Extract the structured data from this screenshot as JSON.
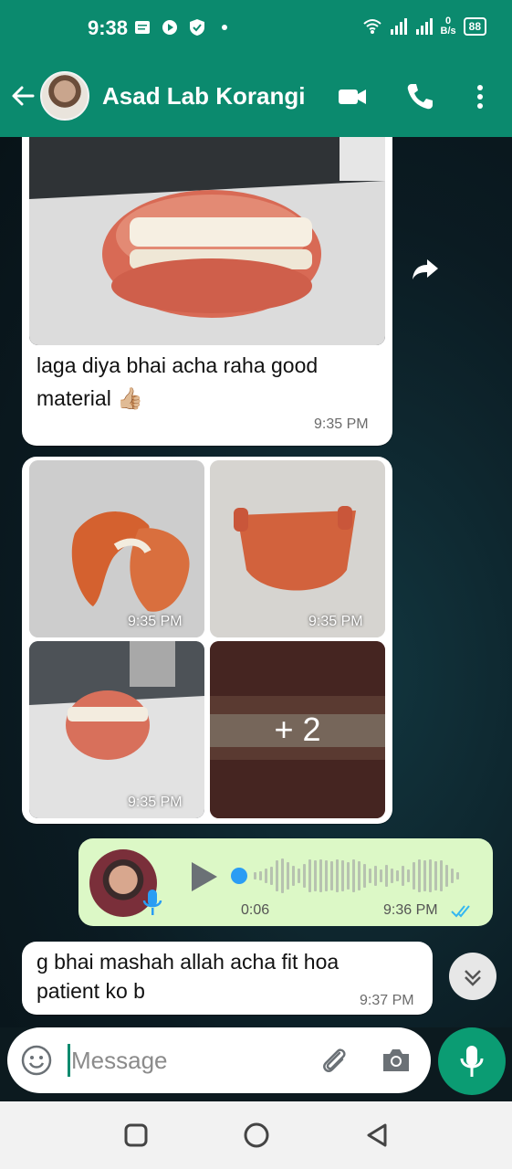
{
  "status_bar": {
    "time": "9:38",
    "net_speed_value": "0",
    "net_speed_unit": "B/s",
    "battery": "88"
  },
  "header": {
    "contact_name": "Asad Lab Korangi"
  },
  "messages": {
    "first": {
      "text_line1": "laga diya bhai acha raha  good",
      "text_line2": "material",
      "emoji": "👍🏼",
      "time": "9:35 PM"
    },
    "gallery": {
      "times": [
        "9:35 PM",
        "9:35 PM",
        "9:35 PM"
      ],
      "more_count": "+ 2"
    },
    "voice": {
      "duration": "0:06",
      "time": "9:36 PM"
    },
    "last": {
      "text_line1": "g bhai mashah allah acha fit hoa",
      "text_line2": "patient ko  b",
      "time": "9:37 PM"
    }
  },
  "composer": {
    "placeholder": "Message"
  },
  "icons": {
    "back": "arrow-left-icon",
    "video": "video-camera-icon",
    "call": "phone-icon",
    "menu": "more-vertical-icon",
    "forward": "forward-arrow-icon",
    "emoji": "emoji-icon",
    "attach": "paperclip-icon",
    "camera": "camera-icon",
    "mic": "mic-icon"
  },
  "colors": {
    "header": "#0b8a6e",
    "outgoing": "#dcf8c6",
    "accent": "#0b9c73",
    "ticks": "#34b7f1"
  }
}
